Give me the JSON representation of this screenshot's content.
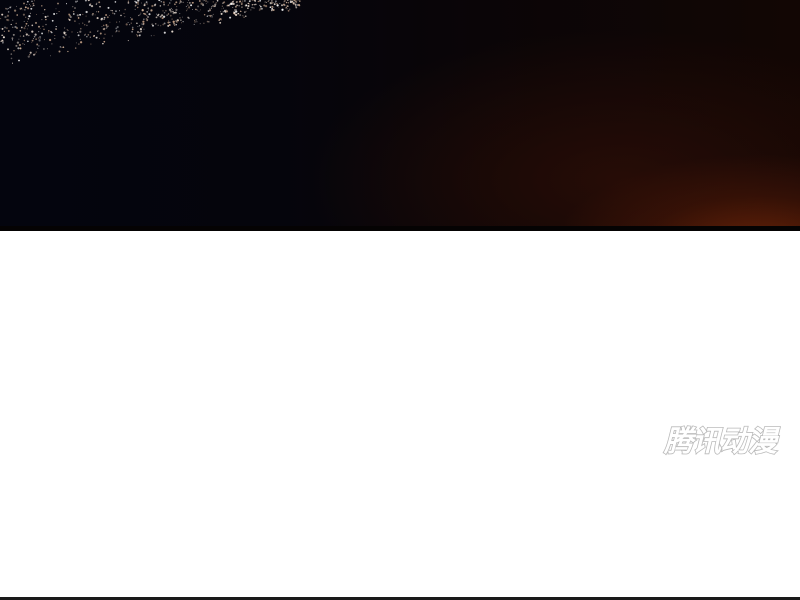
{
  "comic_page": {
    "watermark_text": "腾讯动漫",
    "colors": {
      "night_sky": "#05050c",
      "ember_glow": "#782808",
      "city_light": "#e9d9cc",
      "watermark_fill": "#ffffff",
      "watermark_stroke": "#b9b9b9",
      "background": "#ffffff"
    }
  }
}
